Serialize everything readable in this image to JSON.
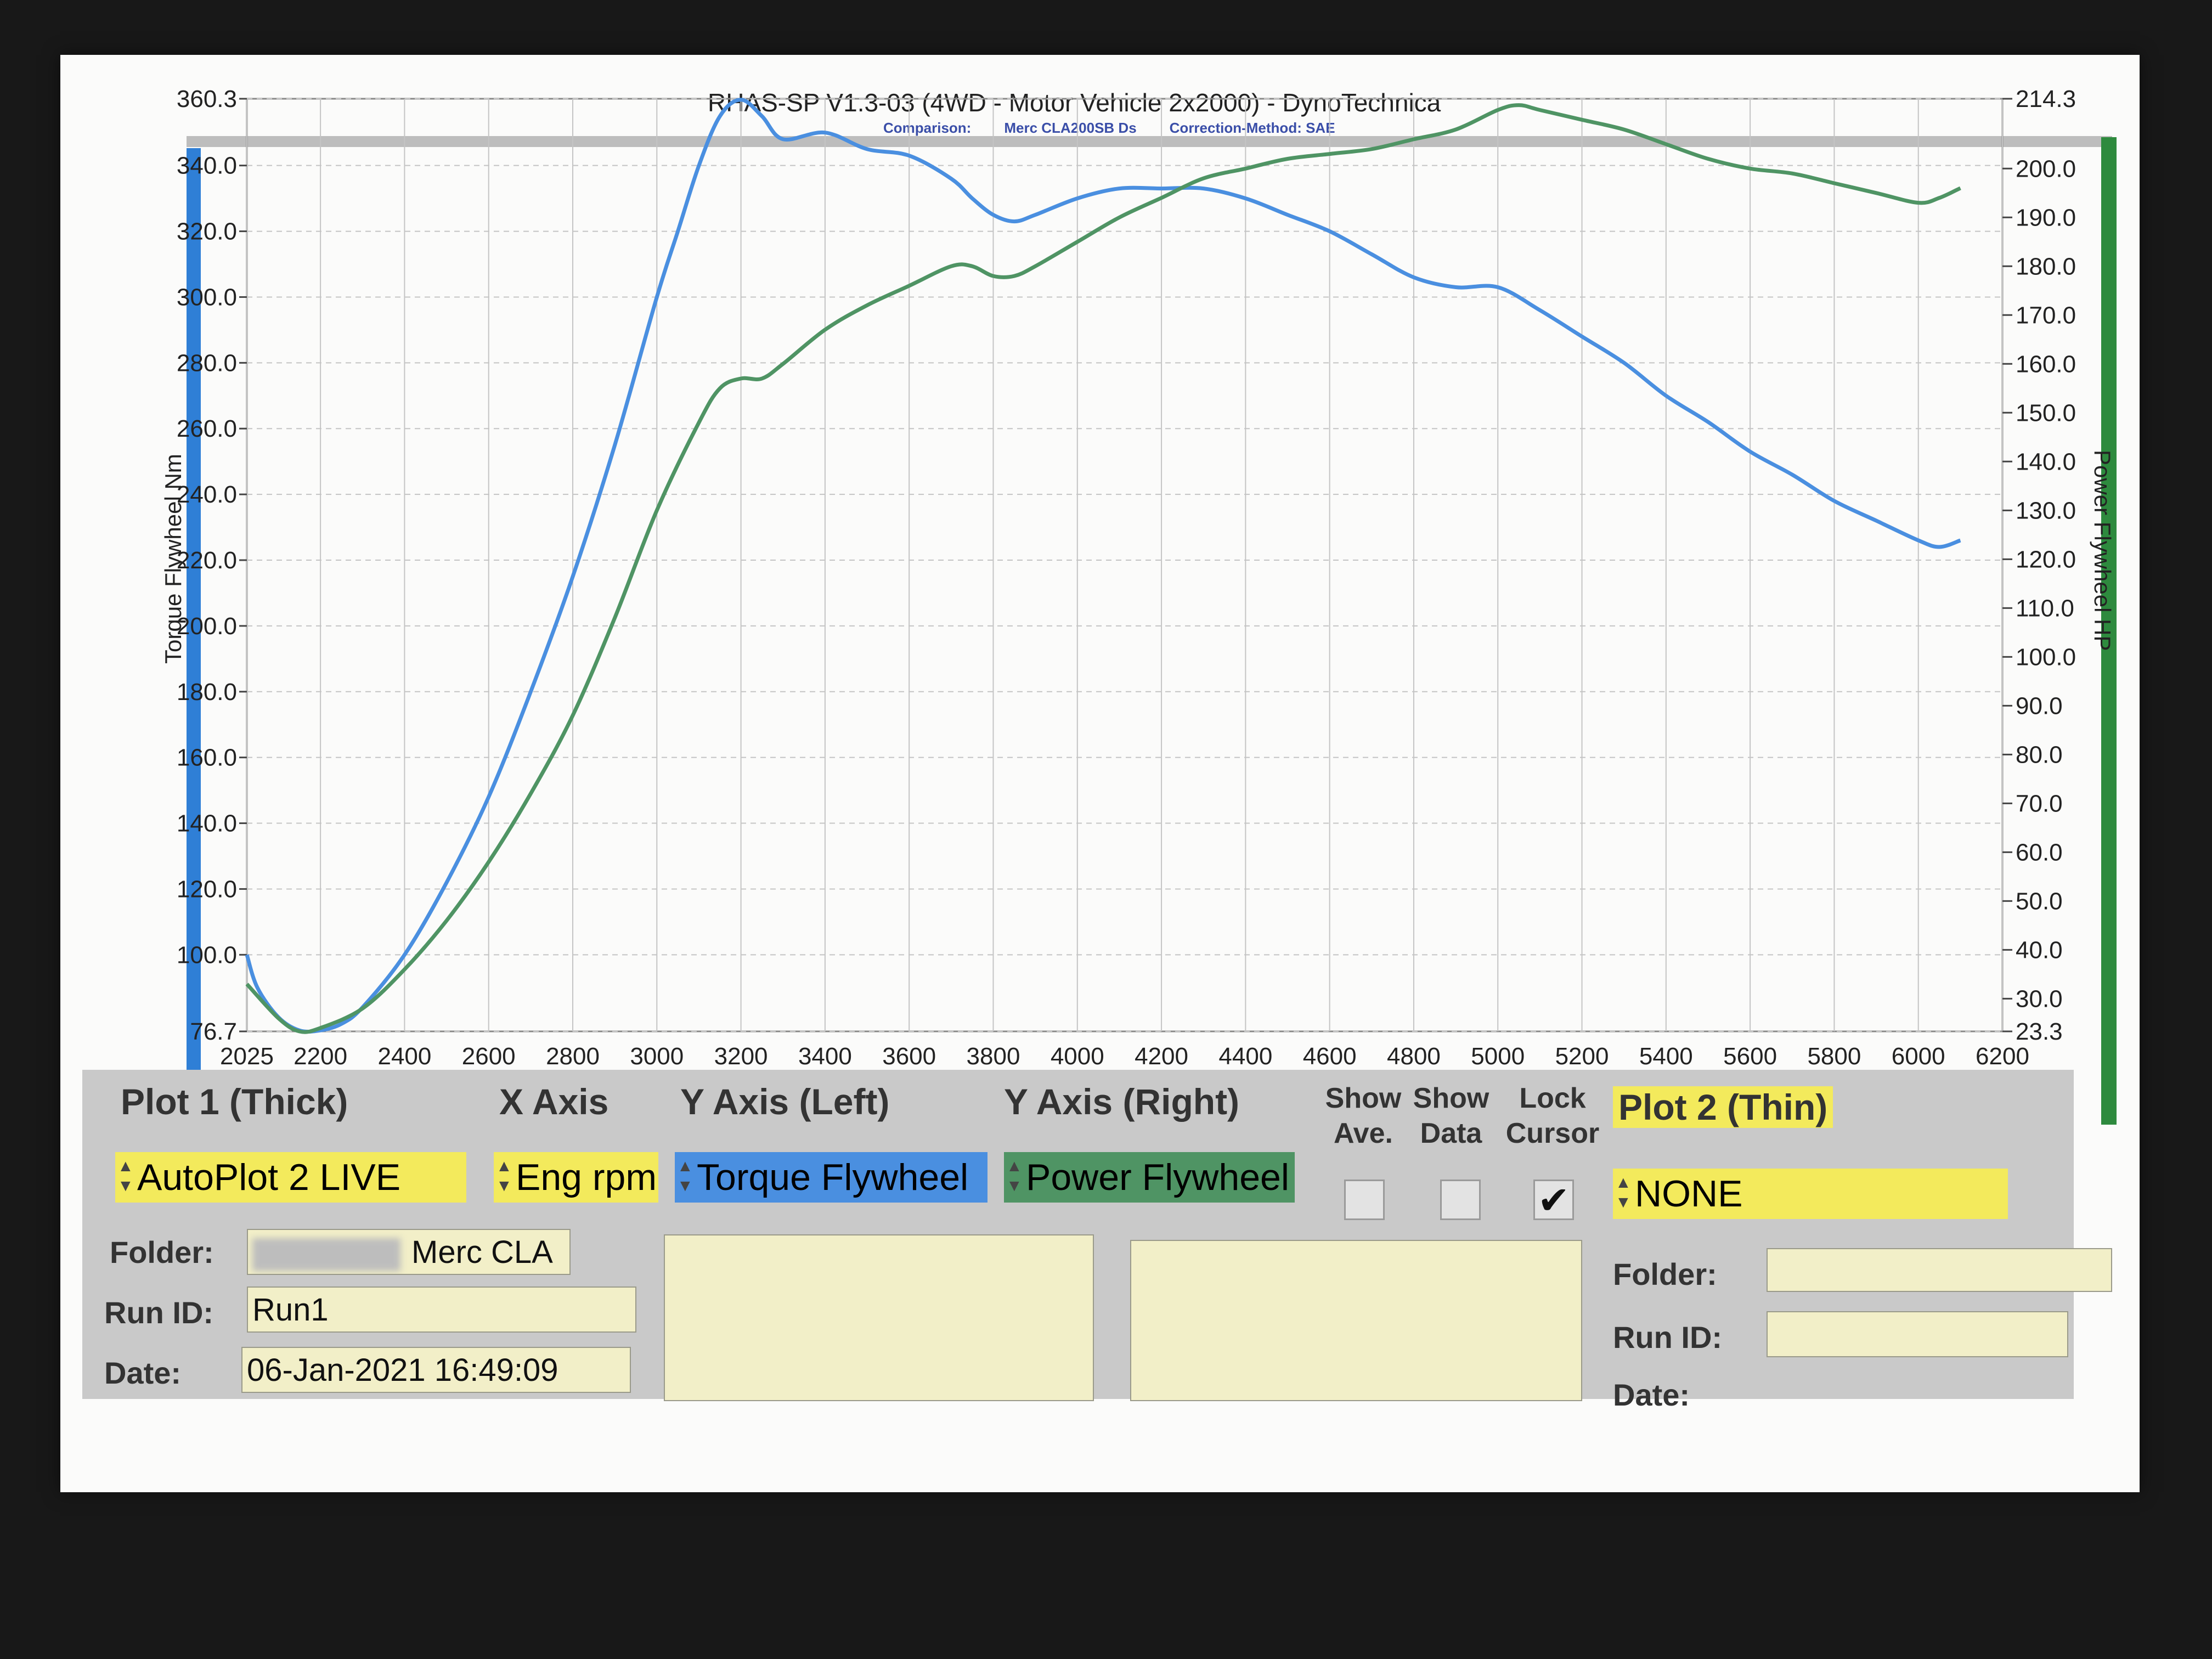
{
  "header": {
    "title": "RHAS-SP V1.3-03  (4WD - Motor Vehicle 2x2000) - DynoTechnica",
    "comparison_label": "Comparison:",
    "vehicle": "Merc CLA200SB Ds",
    "correction": "Correction-Method: SAE"
  },
  "colors": {
    "torque": "#4a8fe0",
    "power": "#4f9464",
    "torque_bar": "#2f7fd6",
    "power_bar": "#2e8a3e",
    "yellow": "#f3ea5c",
    "panel": "#c9c9c9",
    "field": "#f2efc8"
  },
  "chart_data": {
    "type": "line",
    "xlabel": "",
    "ylabel_left": "Torque Flywheel Nm",
    "ylabel_right": "Power Flywheel HP",
    "xlim": [
      2025,
      6200
    ],
    "ylim_left": [
      76.7,
      360.3
    ],
    "ylim_right": [
      23.3,
      214.3
    ],
    "x_ticks": [
      "2025",
      "2200",
      "2400",
      "2600",
      "2800",
      "3000",
      "3200",
      "3400",
      "3600",
      "3800",
      "4000",
      "4200",
      "4400",
      "4600",
      "4800",
      "5000",
      "5200",
      "5400",
      "5600",
      "5800",
      "6000",
      "6200"
    ],
    "y_left_ticks": [
      "76.7",
      "100.0",
      "120.0",
      "140.0",
      "160.0",
      "180.0",
      "200.0",
      "220.0",
      "240.0",
      "260.0",
      "280.0",
      "300.0",
      "320.0",
      "340.0",
      "360.3"
    ],
    "y_right_ticks": [
      "23.3",
      "30.0",
      "40.0",
      "50.0",
      "60.0",
      "70.0",
      "80.0",
      "90.0",
      "100.0",
      "110.0",
      "120.0",
      "130.0",
      "140.0",
      "150.0",
      "160.0",
      "170.0",
      "180.0",
      "190.0",
      "200.0",
      "214.3"
    ],
    "grid": true,
    "series": [
      {
        "name": "Torque Flywheel",
        "axis": "left",
        "x": [
          2025,
          2050,
          2100,
          2150,
          2200,
          2250,
          2300,
          2400,
          2500,
          2600,
          2700,
          2800,
          2900,
          3000,
          3050,
          3100,
          3150,
          3200,
          3250,
          3300,
          3400,
          3500,
          3600,
          3700,
          3750,
          3800,
          3850,
          3900,
          4000,
          4100,
          4200,
          4300,
          4400,
          4500,
          4600,
          4700,
          4800,
          4900,
          5000,
          5100,
          5200,
          5300,
          5400,
          5500,
          5600,
          5700,
          5800,
          5900,
          6000,
          6050,
          6100
        ],
        "y": [
          100,
          90,
          81,
          77,
          77,
          79,
          84,
          100,
          122,
          148,
          180,
          215,
          255,
          300,
          320,
          340,
          355,
          360,
          355,
          348,
          350,
          345,
          343,
          336,
          330,
          325,
          323,
          325,
          330,
          333,
          333,
          333,
          330,
          325,
          320,
          313,
          306,
          303,
          303,
          296,
          288,
          280,
          270,
          262,
          253,
          246,
          238,
          232,
          226,
          224,
          226
        ]
      },
      {
        "name": "Power Flywheel",
        "axis": "right",
        "x": [
          2025,
          2100,
          2150,
          2200,
          2300,
          2400,
          2500,
          2600,
          2700,
          2800,
          2900,
          3000,
          3100,
          3150,
          3200,
          3250,
          3300,
          3400,
          3500,
          3600,
          3700,
          3750,
          3800,
          3850,
          3900,
          4000,
          4100,
          4200,
          4300,
          4400,
          4500,
          4600,
          4700,
          4800,
          4900,
          5000,
          5050,
          5100,
          5200,
          5300,
          5400,
          5500,
          5600,
          5700,
          5800,
          5900,
          6000,
          6050,
          6100
        ],
        "y": [
          33,
          26,
          23.3,
          24,
          28,
          36,
          46,
          58,
          72,
          88,
          108,
          130,
          148,
          155,
          157,
          157,
          160,
          167,
          172,
          176,
          180,
          180,
          178,
          178,
          180,
          185,
          190,
          194,
          198,
          200,
          202,
          203,
          204,
          206,
          208,
          212,
          213,
          212,
          210,
          208,
          205,
          202,
          200,
          199,
          197,
          195,
          193,
          194,
          196
        ]
      }
    ]
  },
  "panel": {
    "plot1_label": "Plot 1 (Thick)",
    "xaxis_label": "X Axis",
    "yleft_label": "Y Axis (Left)",
    "yright_label": "Y Axis (Right)",
    "show_ave_label": "Show\nAve.",
    "show_data_label": "Show\nData",
    "lock_cursor_label": "Lock\nCursor",
    "plot2_label": "Plot 2 (Thin)",
    "plot1_value": "AutoPlot 2 LIVE",
    "xaxis_value": "Eng rpm",
    "yleft_value": "Torque Flywheel",
    "yright_value": "Power Flywheel",
    "plot2_value": "NONE",
    "show_ave_checked": false,
    "show_data_checked": false,
    "lock_cursor_checked": true,
    "left": {
      "folder_label": "Folder:",
      "folder_value": "Merc CLA",
      "runid_label": "Run ID:",
      "runid_value": "Run1",
      "date_label": "Date:",
      "date_value": "06-Jan-2021  16:49:09"
    },
    "right": {
      "folder_label": "Folder:",
      "runid_label": "Run ID:",
      "date_label": "Date:"
    }
  }
}
